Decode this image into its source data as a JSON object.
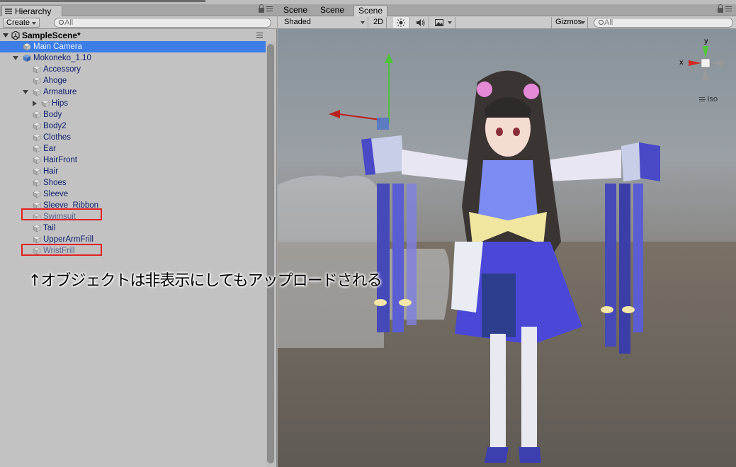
{
  "hierarchy": {
    "tab_label": "Hierarchy",
    "create_label": "Create",
    "search_placeholder": "All",
    "scene_name": "SampleScene*",
    "items": [
      {
        "label": "Main Camera",
        "depth": 1,
        "selected": true,
        "hidden": false
      },
      {
        "label": "Mokoneko_1.10",
        "depth": 1,
        "expanded": true,
        "hidden": false
      },
      {
        "label": "Accessory",
        "depth": 2,
        "hidden": false
      },
      {
        "label": "Ahoge",
        "depth": 2,
        "hidden": false
      },
      {
        "label": "Armature",
        "depth": 2,
        "expanded": true,
        "hidden": false
      },
      {
        "label": "Hips",
        "depth": 3,
        "collapsed": true,
        "hidden": false
      },
      {
        "label": "Body",
        "depth": 2,
        "hidden": false
      },
      {
        "label": "Body2",
        "depth": 2,
        "hidden": false
      },
      {
        "label": "Clothes",
        "depth": 2,
        "hidden": false
      },
      {
        "label": "Ear",
        "depth": 2,
        "hidden": false
      },
      {
        "label": "HairFront",
        "depth": 2,
        "hidden": false
      },
      {
        "label": "Hair",
        "depth": 2,
        "hidden": false
      },
      {
        "label": "Shoes",
        "depth": 2,
        "hidden": false
      },
      {
        "label": "Sleeve",
        "depth": 2,
        "hidden": false
      },
      {
        "label": "Sleeve_Ribbon",
        "depth": 2,
        "hidden": false
      },
      {
        "label": "Swimsuit",
        "depth": 2,
        "hidden": true
      },
      {
        "label": "Tail",
        "depth": 2,
        "hidden": false
      },
      {
        "label": "UpperArmFrill",
        "depth": 2,
        "hidden": false
      },
      {
        "label": "WristFrill",
        "depth": 2,
        "hidden": true
      }
    ]
  },
  "scene": {
    "tabs": [
      "Scene",
      "Scene",
      "Scene"
    ],
    "active_tab": 2,
    "shading_mode": "Shaded",
    "mode_2d": "2D",
    "gizmos_label": "Gizmos",
    "search_placeholder": "All",
    "gizmo_axes": {
      "x": "x",
      "y": "y"
    },
    "projection": "Iso"
  },
  "annotation": "↑オブジェクトは非表示にしてもアップロードされる",
  "colors": {
    "selection": "#3d7ee6",
    "highlight_box": "#e12222",
    "item_text": "#0c1d6b",
    "hidden_text": "#5b6490"
  }
}
